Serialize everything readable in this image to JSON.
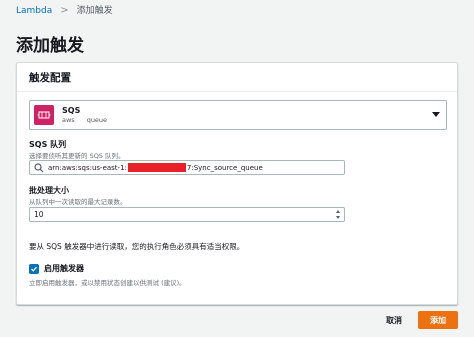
{
  "breadcrumb": {
    "root": "Lambda",
    "separator": ">",
    "current": "添加触发"
  },
  "page_title": "添加触发",
  "panel": {
    "title": "触发配置",
    "source": {
      "name": "SQS",
      "tags": [
        "aws",
        "queue"
      ],
      "icon": "sqs-icon",
      "icon_color": "#cd2264"
    },
    "queue_field": {
      "label": "SQS 队列",
      "description": "选择要侦听其更新的 SQS 队列。",
      "value_prefix": "arn:aws:sqs:us-east-1:",
      "value_suffix": "7:Sync_source_queue"
    },
    "batch_field": {
      "label": "批处理大小",
      "description": "从队列中一次读取的最大记录数。",
      "value": "10"
    },
    "permission_note": "要从 SQS 触发器中进行读取，您的执行角色必须具有适当权限。",
    "enable_trigger": {
      "label": "启用触发器",
      "checked": true,
      "description": "立即启用触发器，或以禁用状态创建以供测试 (建议)。"
    }
  },
  "footer": {
    "cancel_label": "取消",
    "add_label": "添加"
  },
  "colors": {
    "accent": "#ec7211",
    "link": "#0073bb"
  }
}
